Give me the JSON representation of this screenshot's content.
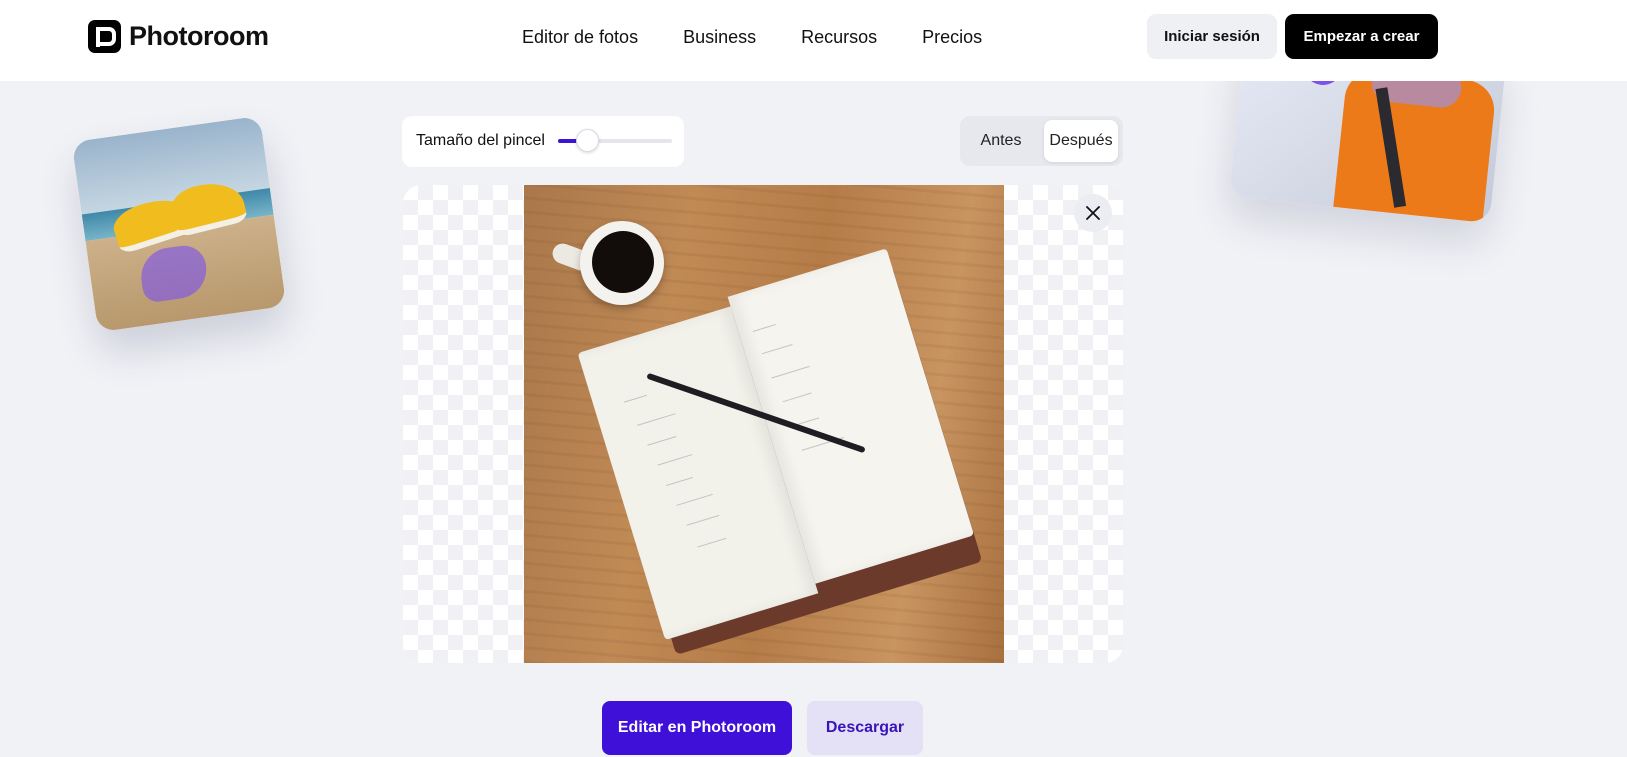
{
  "brand": {
    "name": "Photoroom"
  },
  "nav": {
    "items": [
      {
        "label": "Editor de fotos"
      },
      {
        "label": "Business"
      },
      {
        "label": "Recursos"
      },
      {
        "label": "Precios"
      }
    ]
  },
  "header": {
    "login_label": "Iniciar sesión",
    "start_label": "Empezar a crear"
  },
  "editor": {
    "brush_label": "Tamaño del pincel",
    "brush_size": 0.25,
    "toggle": {
      "before_label": "Antes",
      "after_label": "Después",
      "selected": "Después"
    }
  },
  "actions": {
    "edit_label": "Editar en Photoroom",
    "download_label": "Descargar"
  },
  "colors": {
    "accent": "#3f10d8",
    "accent_soft": "#e4e0f6",
    "page_bg": "#f1f2f6"
  },
  "icons": {
    "close": "close-icon",
    "logo": "photoroom-logo-icon"
  }
}
